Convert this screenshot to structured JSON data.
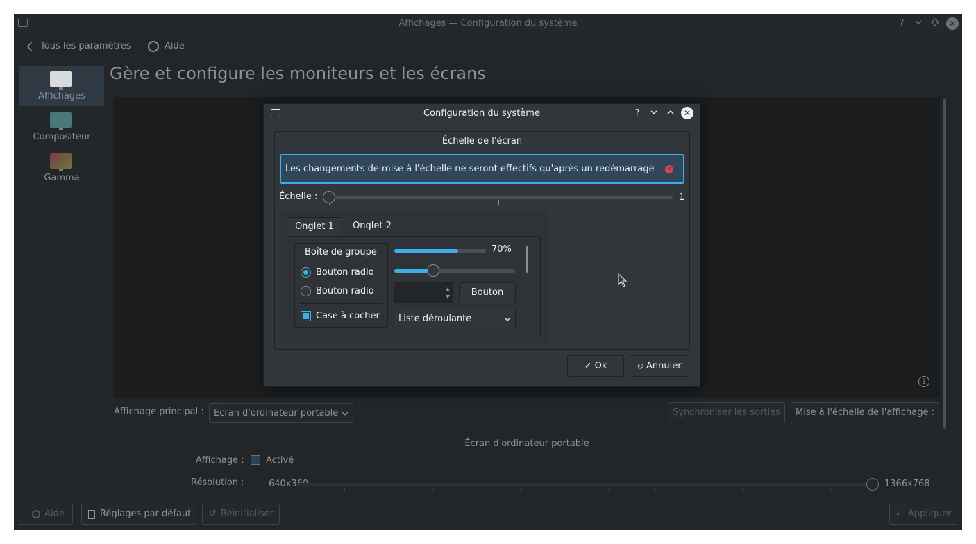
{
  "window": {
    "title": "Affichages — Configuration du système",
    "controls": {
      "help": "?",
      "minimize": "⌄",
      "maximize": "◇",
      "close": "✕"
    }
  },
  "nav": {
    "back_label": "Tous les paramètres",
    "help_label": "Aide"
  },
  "sidebar": {
    "items": [
      {
        "label": "Affichages",
        "icon": "monitor-icon",
        "active": true
      },
      {
        "label": "Compositeur",
        "icon": "compositor-icon",
        "active": false
      },
      {
        "label": "Gamma",
        "icon": "gamma-icon",
        "active": false
      }
    ]
  },
  "page_title": "Gère et configure les moniteurs et les écrans",
  "primary_display": {
    "label": "Affichage principal :",
    "value": "Écran d'ordinateur portable"
  },
  "buttons": {
    "sync_outputs": "Synchroniser les sorties",
    "display_scaling": "Mise à l'échelle de l'affichage :"
  },
  "output": {
    "title": "Écran d'ordinateur portable",
    "display_label": "Affichage :",
    "enabled_label": "Activé",
    "resolution_label": "Résolution :",
    "resolution_min": "640x360",
    "resolution_max": "1366x768",
    "resolution_position": 1.0
  },
  "footer": {
    "help": "Aide",
    "defaults": "Réglages par défaut",
    "reset": "Réinitialiser",
    "apply": "Appliquer"
  },
  "dialog": {
    "title": "Configuration du système",
    "controls": {
      "help": "?",
      "minimize": "⌄",
      "maximize": "⌃",
      "close": "✕"
    },
    "frame_title": "Échelle de l'écran",
    "message": "Les changements de mise à l'échelle ne seront effectifs qu'après un redémarrage",
    "scale_label": "Échelle :",
    "scale_value": "1",
    "tabs": [
      "Onglet 1",
      "Onglet 2"
    ],
    "groupbox": {
      "title": "Boîte de groupe",
      "radio1": "Bouton radio",
      "radio2": "Bouton radio",
      "checkbox": "Case à cocher"
    },
    "progress": {
      "value": 70,
      "label": "70%"
    },
    "slider_level": 0.32,
    "button_label": "Bouton",
    "combo_label": "Liste déroulante",
    "ok": "Ok",
    "cancel": "Annuler"
  },
  "colors": {
    "accent": "#3daee9",
    "dialog_bg": "#31363b",
    "background": "#232629",
    "error": "#da4453"
  }
}
